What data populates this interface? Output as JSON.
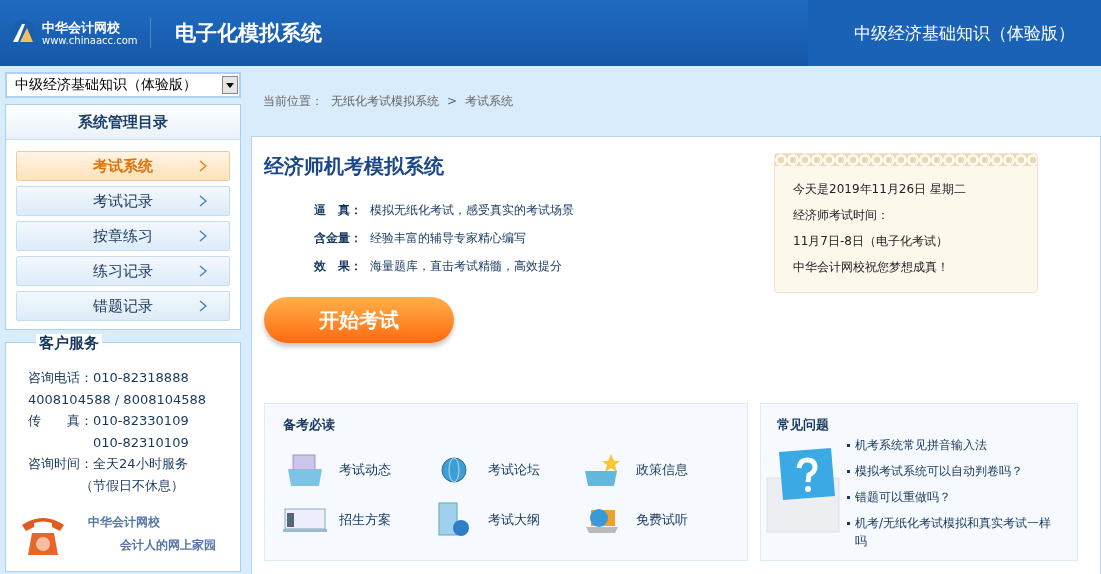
{
  "header": {
    "logo_name": "中华会计网校",
    "logo_url": "www.chinaacc.com",
    "title": "电子化模拟系统",
    "subject": "中级经济基础知识（体验版）"
  },
  "sidebar": {
    "subject_select": {
      "value": "中级经济基础知识（体验版）"
    },
    "menu_title": "系统管理目录",
    "menu": [
      {
        "label": "考试系统",
        "selected": true
      },
      {
        "label": "考试记录",
        "selected": false
      },
      {
        "label": "按章练习",
        "selected": false
      },
      {
        "label": "练习记录",
        "selected": false
      },
      {
        "label": "错题记录",
        "selected": false
      }
    ],
    "service": {
      "title": "客户服务",
      "lines": [
        "咨询电话：010-82318888",
        "4008104588 / 8008104588",
        "传　　真：010-82330109",
        "　　　　　010-82310109",
        "咨询时间：全天24小时服务",
        "　　　　（节假日不休息）"
      ],
      "footer_name": "中华会计网校",
      "footer_slogan": "会计人的网上家园"
    }
  },
  "breadcrumb": {
    "label": "当前位置：",
    "items": [
      "无纸化考试模拟系统",
      "考试系统"
    ],
    "separator": ">"
  },
  "intro": {
    "title": "经济师机考模拟系统",
    "features": [
      {
        "label": "逼　真：",
        "text": "模拟无纸化考试，感受真实的考试场景"
      },
      {
        "label": "含金量：",
        "text": "经验丰富的辅导专家精心编写"
      },
      {
        "label": "效　果：",
        "text": "海量题库，直击考试精髓，高效提分"
      }
    ],
    "start_button": "开始考试"
  },
  "notice": {
    "lines": [
      "今天是2019年11月26日 星期二",
      "经济师考试时间：",
      "11月7日-8日（电子化考试）",
      "中华会计网校祝您梦想成真！"
    ]
  },
  "reading": {
    "title": "备考必读",
    "links": [
      {
        "label": "考试动态",
        "kind": "folder"
      },
      {
        "label": "考试论坛",
        "kind": "globe"
      },
      {
        "label": "政策信息",
        "kind": "star"
      },
      {
        "label": "招生方案",
        "kind": "certificate"
      },
      {
        "label": "考试大纲",
        "kind": "book"
      },
      {
        "label": "免费试听",
        "kind": "laptop"
      }
    ]
  },
  "faq": {
    "title": "常见问题",
    "items": [
      "机考系统常见拼音输入法",
      "模拟考试系统可以自动判卷吗？",
      "错题可以重做吗？",
      "机考/无纸化考试模拟和真实考试一样吗"
    ]
  }
}
